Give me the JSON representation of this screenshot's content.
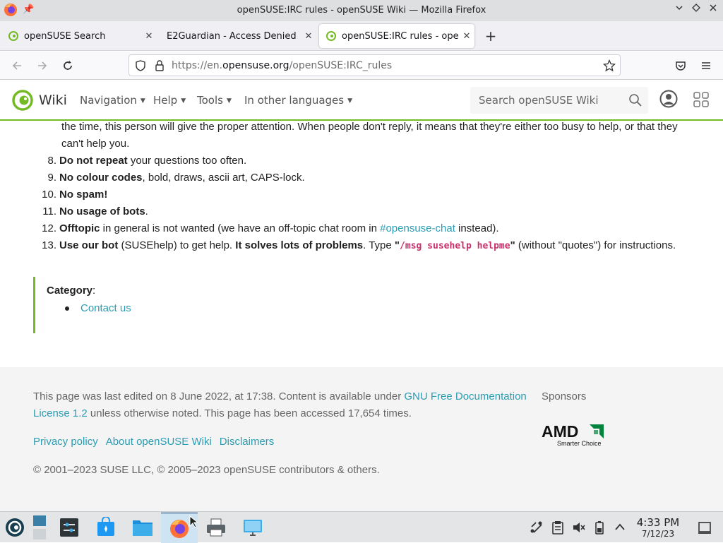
{
  "window": {
    "title": "openSUSE:IRC rules - openSUSE Wiki — Mozilla Firefox",
    "controls": [
      "chevron-down-icon",
      "diamond-icon",
      "close-icon"
    ]
  },
  "tabs": [
    {
      "label": "openSUSE Search",
      "active": false,
      "close": "✕"
    },
    {
      "label": "E2Guardian - Access Denied",
      "active": false,
      "close": "✕"
    },
    {
      "label": "openSUSE:IRC rules - openS",
      "active": true,
      "close": "✕"
    }
  ],
  "newtab_label": "+",
  "urlbar": {
    "scheme": "https://en.",
    "host": "opensuse.org",
    "path": "/openSUSE:IRC_rules"
  },
  "wiki": {
    "name": "Wiki",
    "menus": [
      "Navigation",
      "Help",
      "Tools",
      "In other languages"
    ],
    "search_placeholder": "Search openSUSE Wiki",
    "accent_color": "#73ba25"
  },
  "content": {
    "continuation": "the time, this person will give the proper attention. When people don't reply, it means that they're either too busy to help, or that they can't help you.",
    "rules": [
      {
        "num": "8.",
        "bold": "Do not repeat",
        "text": " your questions too often."
      },
      {
        "num": "9.",
        "bold": "No colour codes",
        "text": ", bold, draws, ascii art, CAPS-lock."
      },
      {
        "num": "10.",
        "bold": "No spam!",
        "text": ""
      },
      {
        "num": "11.",
        "bold": "No usage of bots",
        "text": "."
      },
      {
        "num": "12.",
        "bold": "Offtopic",
        "text": " in general is not wanted (we have an off-topic chat room in ",
        "link": "#opensuse-chat",
        "after": " instead)."
      },
      {
        "num": "13.",
        "bold": "Use our bot",
        "text": " (SUSEhelp) to get help. ",
        "bold2": "It solves lots of problems",
        "text2": ". Type ",
        "q1": "\"",
        "code": "/msg susehelp helpme",
        "q2": "\"",
        "after": " (without \"quotes\") for instructions."
      }
    ],
    "category_label": "Category",
    "category_colon": ":",
    "category_items": [
      "Contact us"
    ]
  },
  "footer": {
    "lastmod_text": "This page was last edited on 8 June 2022, at 17:38. Content is available under ",
    "license_link": "GNU Free Documentation License 1.2",
    "lastmod_after": " unless otherwise noted. This page has been accessed 17,654 times.",
    "links": [
      "Privacy policy",
      "About openSUSE Wiki",
      "Disclaimers"
    ],
    "copyright": "© 2001–2023 SUSE LLC, © 2005–2023 openSUSE contributors & others.",
    "sponsors_label": "Sponsors",
    "sponsor_logo_text": "AMD",
    "sponsor_tagline": "Smarter Choice"
  },
  "taskbar": {
    "items": [
      "opensuse-start-icon",
      "desktop-pager",
      "system-settings-icon",
      "discover-icon",
      "file-manager-icon",
      "firefox-icon",
      "printer-icon",
      "remote-desktop-icon"
    ],
    "tray": [
      "network-icon",
      "clipboard-icon",
      "volume-muted-icon",
      "battery-icon",
      "tray-expand-icon"
    ],
    "time": "4:33 PM",
    "date": "7/12/23"
  }
}
